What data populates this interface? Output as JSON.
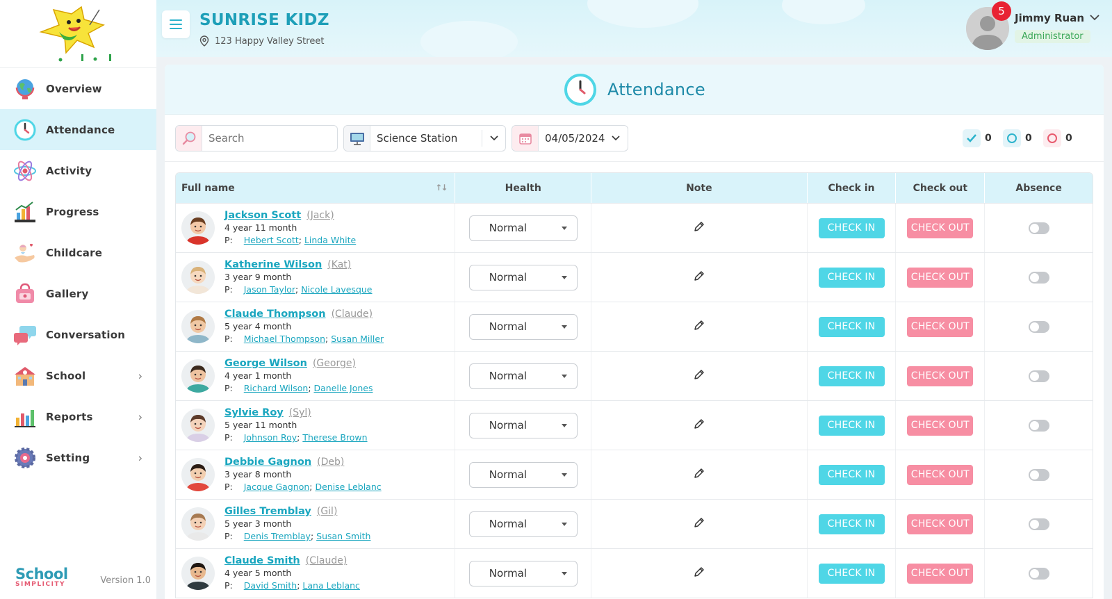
{
  "sidebar": {
    "items": [
      {
        "label": "Overview",
        "icon": "globe-icon",
        "active": false,
        "chevron": false
      },
      {
        "label": "Attendance",
        "icon": "clock-icon",
        "active": true,
        "chevron": false
      },
      {
        "label": "Activity",
        "icon": "atom-icon",
        "active": false,
        "chevron": false
      },
      {
        "label": "Progress",
        "icon": "progress-chart-icon",
        "active": false,
        "chevron": false
      },
      {
        "label": "Childcare",
        "icon": "childcare-hand-icon",
        "active": false,
        "chevron": false
      },
      {
        "label": "Gallery",
        "icon": "gallery-bag-icon",
        "active": false,
        "chevron": false
      },
      {
        "label": "Conversation",
        "icon": "chat-bubbles-icon",
        "active": false,
        "chevron": false
      },
      {
        "label": "School",
        "icon": "school-building-icon",
        "active": false,
        "chevron": true
      },
      {
        "label": "Reports",
        "icon": "bar-chart-icon",
        "active": false,
        "chevron": true
      },
      {
        "label": "Setting",
        "icon": "gear-icon",
        "active": false,
        "chevron": true
      }
    ],
    "brand_main": "School",
    "brand_sub": "SIMPLICITY",
    "version": "Version 1.0"
  },
  "header": {
    "school_name": "SUNRISE KIDZ",
    "address": "123 Happy Valley Street",
    "notifications": "5",
    "user_name": "Jimmy Ruan",
    "user_role": "Administrator"
  },
  "page": {
    "title": "Attendance"
  },
  "toolbar": {
    "search_placeholder": "Search",
    "station": "Science Station",
    "date": "04/05/2024",
    "counts": {
      "checked": "0",
      "pending": "0",
      "absent": "0"
    }
  },
  "table": {
    "columns": {
      "full_name": "Full name",
      "health": "Health",
      "note": "Note",
      "check_in": "Check in",
      "check_out": "Check out",
      "absence": "Absence"
    },
    "check_in_label": "CHECK IN",
    "check_out_label": "CHECK OUT",
    "parent_prefix": "P:",
    "rows": [
      {
        "name": "Jackson Scott",
        "nick": "(Jack)",
        "age": "4 year 11 month",
        "parent1": "Hebert Scott",
        "parent2": "Linda White",
        "health": "Normal",
        "skin": "#f3c9a8",
        "hair": "#6b3f22",
        "shirt": "#d9342b"
      },
      {
        "name": "Katherine Wilson",
        "nick": "(Kat)",
        "age": "3 year 9 month",
        "parent1": "Jason Taylor",
        "parent2": "Nicole Lavesque",
        "health": "Normal",
        "skin": "#f6d9bf",
        "hair": "#d9b27a",
        "shirt": "#f2e6d8"
      },
      {
        "name": "Claude Thompson",
        "nick": "(Claude)",
        "age": "5 year 4 month",
        "parent1": "Michael Thompson",
        "parent2": "Susan Miller",
        "health": "Normal",
        "skin": "#f0c8a4",
        "hair": "#b07a45",
        "shirt": "#8fb7c9"
      },
      {
        "name": "George Wilson",
        "nick": "(George)",
        "age": "4 year 1 month",
        "parent1": "Richard Wilson",
        "parent2": "Danelle Jones",
        "health": "Normal",
        "skin": "#eec3a0",
        "hair": "#3b2a1e",
        "shirt": "#3da9a0"
      },
      {
        "name": "Sylvie Roy",
        "nick": "(Syl)",
        "age": "5 year 11 month",
        "parent1": "Johnson Roy",
        "parent2": "Therese Brown",
        "health": "Normal",
        "skin": "#f4d3bb",
        "hair": "#5c3b2a",
        "shirt": "#d9cfe6"
      },
      {
        "name": "Debbie Gagnon",
        "nick": "(Deb)",
        "age": "3 year 8 month",
        "parent1": "Jacque Gagnon",
        "parent2": "Denise Leblanc",
        "health": "Normal",
        "skin": "#f2cfb0",
        "hair": "#2a1c14",
        "shirt": "#e2483d"
      },
      {
        "name": "Gilles Tremblay",
        "nick": "(Gil)",
        "age": "5 year 3 month",
        "parent1": "Denis Tremblay",
        "parent2": "Susan Smith",
        "health": "Normal",
        "skin": "#f3d1b6",
        "hair": "#a67a52",
        "shirt": "#e9e9e9"
      },
      {
        "name": "Claude Smith",
        "nick": "(Claude)",
        "age": "4 year 5 month",
        "parent1": "David Smith",
        "parent2": "Lana Leblanc",
        "health": "Normal",
        "skin": "#e8b98f",
        "hair": "#1f1712",
        "shirt": "#2f3a3f"
      }
    ]
  },
  "colors": {
    "accent": "#1e9fb8",
    "active_bg": "#d9f3fa",
    "check_in": "#4fd6e6",
    "check_out": "#f78ea3",
    "badge": "#e82233"
  }
}
